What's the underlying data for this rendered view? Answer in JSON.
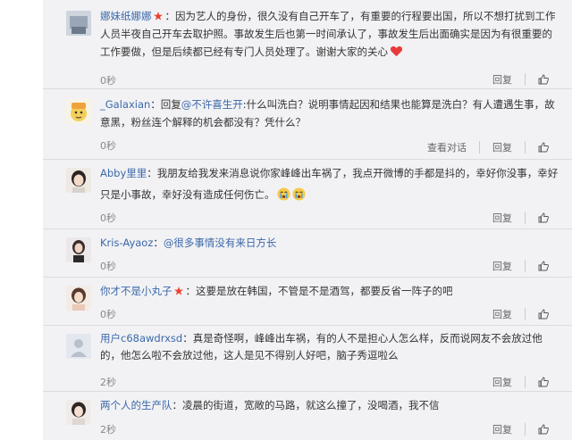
{
  "actions": {
    "reply": "回复",
    "view_conversation": "查看对话"
  },
  "comments": [
    {
      "user": "娜妹纸娜娜",
      "star": true,
      "separator": "：",
      "text": "因为艺人的身份，很久没有自己开车了，有重要的行程要出国，所以不想打扰到工作人员半夜自己开车去取护照。事故发生后也第一时间承认了，事故发生后出面确实是因为有很重要的工作要做，但是后续都已经有专门人员处理了。谢谢大家的关心",
      "time": "0秒",
      "emoji": "heart"
    },
    {
      "user": "_Galaxian",
      "separator": "：回复",
      "mention": "@不许喜生开",
      "text": ":什么叫洗白？说明事情起因和结果也能算是洗白？有人遭遇生事，故意黑，粉丝连个解释的机会都没有？凭什么？",
      "time": "0秒",
      "view_conversation": true
    },
    {
      "user": "Abby里里",
      "separator": "：",
      "text": "我朋友给我发来消息说你家峰峰出车祸了，我点开微博的手都是抖的，幸好你没事，幸好只是小事故，幸好没有造成任何伤亡。",
      "time": "0秒",
      "emoji": "cry"
    },
    {
      "user": "Kris-Ayaoz",
      "separator": "：",
      "mention": "@很多事情没有来日方长",
      "text": "",
      "time": "0秒"
    },
    {
      "user": "你才不是小丸子",
      "star": true,
      "separator": "：",
      "text": "这要是放在韩国，不管是不是酒驾，都要反省一阵子的吧",
      "time": "0秒"
    },
    {
      "user": "用户c68awdrxsd",
      "separator": "：",
      "text": "真是奇怪啊，峰峰出车祸，有的人不是担心人怎么样，反而说网友不会放过他的，他怎么啦不会放过他，这人是见不得别人好吧，脑子秀逗啦么",
      "time": "2秒"
    },
    {
      "user": "两个人的生产队",
      "separator": "：",
      "text": "凌晨的街道，宽敞的马路，就这么撞了，没喝酒，我不信",
      "time": "2秒"
    }
  ],
  "colors": {
    "link": "#3b68a8",
    "panel": "#f2f2f5",
    "star": "#e8402f",
    "heart": "#e83a3a"
  }
}
